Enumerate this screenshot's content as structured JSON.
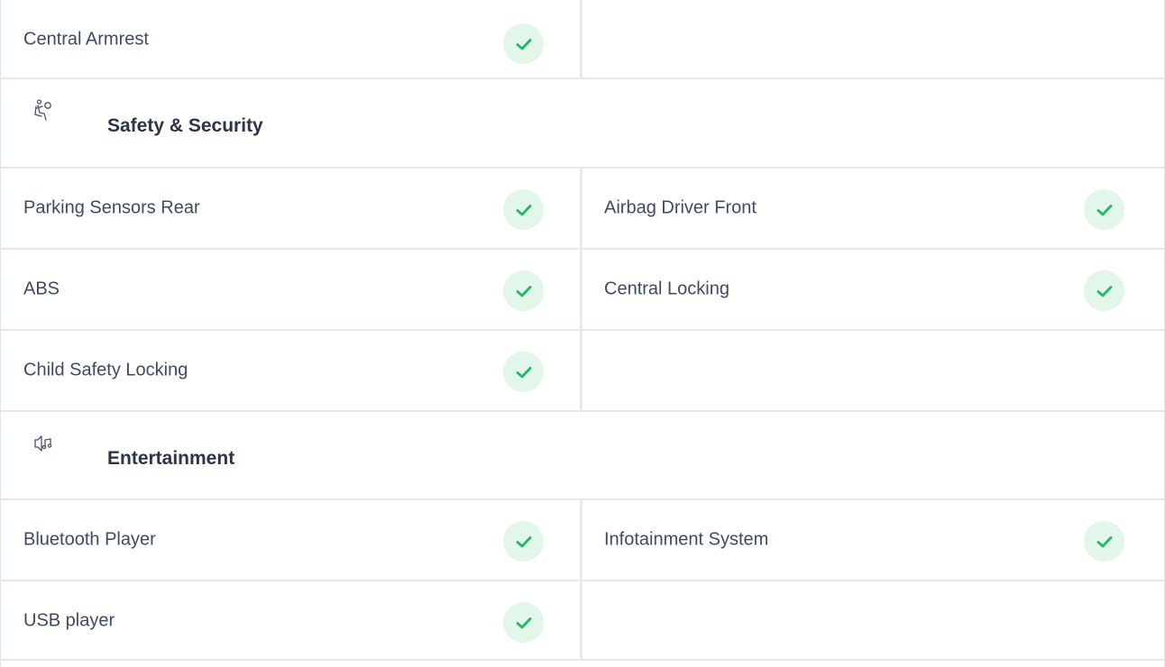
{
  "colors": {
    "check_bg": "#e2f6ea",
    "check_mark": "#1fb865",
    "divider": "#e3e9ef",
    "text": "#3e4b5e",
    "heading": "#2c3546"
  },
  "top_row": {
    "left": {
      "label": "Central Armrest",
      "icon": "check-icon"
    },
    "right": {
      "label": ""
    }
  },
  "sections": [
    {
      "title": "Safety & Security",
      "icon": "seatbelt-icon",
      "rows": [
        {
          "left": "Parking Sensors Rear",
          "right": "Airbag Driver Front"
        },
        {
          "left": "ABS",
          "right": "Central Locking"
        },
        {
          "left": "Child Safety Locking",
          "right": ""
        }
      ]
    },
    {
      "title": "Entertainment",
      "icon": "speaker-music-icon",
      "rows": [
        {
          "left": "Bluetooth Player",
          "right": "Infotainment System"
        },
        {
          "left": "USB player",
          "right": ""
        }
      ]
    }
  ]
}
